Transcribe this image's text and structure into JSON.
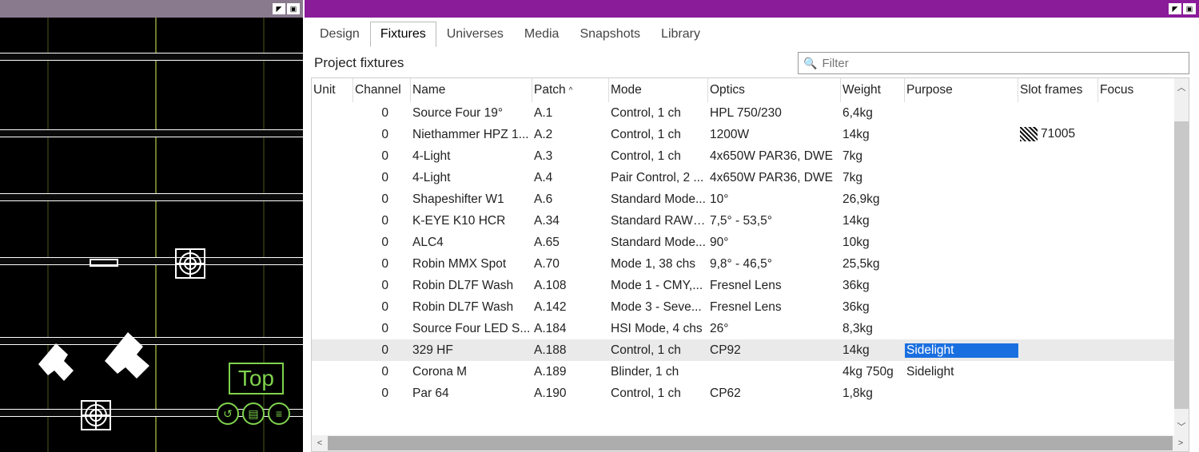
{
  "left": {
    "view_label": "Top"
  },
  "right": {
    "tabs": [
      {
        "label": "Design"
      },
      {
        "label": "Fixtures"
      },
      {
        "label": "Universes"
      },
      {
        "label": "Media"
      },
      {
        "label": "Snapshots"
      },
      {
        "label": "Library"
      }
    ],
    "active_tab": 1,
    "subhead": "Project fixtures",
    "filter_placeholder": "Filter",
    "columns": [
      {
        "label": "Unit"
      },
      {
        "label": "Channel"
      },
      {
        "label": "Name"
      },
      {
        "label": "Patch",
        "sorted": true
      },
      {
        "label": "Mode"
      },
      {
        "label": "Optics"
      },
      {
        "label": "Weight"
      },
      {
        "label": "Purpose"
      },
      {
        "label": "Slot frames"
      },
      {
        "label": "Focus"
      }
    ],
    "rows": [
      {
        "unit": "",
        "channel": "0",
        "name": "Source Four 19°",
        "patch": "A.1",
        "mode": "Control, 1 ch",
        "optics": "HPL 750/230",
        "weight": "6,4kg",
        "purpose": "",
        "slot": "",
        "focus": ""
      },
      {
        "unit": "",
        "channel": "0",
        "name": "Niethammer HPZ 1...",
        "patch": "A.2",
        "mode": "Control, 1 ch",
        "optics": "1200W",
        "weight": "14kg",
        "purpose": "",
        "slot": "71005",
        "slot_icon": true,
        "focus": ""
      },
      {
        "unit": "",
        "channel": "0",
        "name": "4-Light",
        "patch": "A.3",
        "mode": "Control, 1 ch",
        "optics": "4x650W PAR36, DWE",
        "weight": "7kg",
        "purpose": "",
        "slot": "",
        "focus": ""
      },
      {
        "unit": "",
        "channel": "0",
        "name": "4-Light",
        "patch": "A.4",
        "mode": "Pair Control, 2 ...",
        "optics": "4x650W PAR36, DWE",
        "weight": "7kg",
        "purpose": "",
        "slot": "",
        "focus": ""
      },
      {
        "unit": "",
        "channel": "0",
        "name": "Shapeshifter W1",
        "patch": "A.6",
        "mode": "Standard Mode...",
        "optics": "10°",
        "weight": "26,9kg",
        "purpose": "",
        "slot": "",
        "focus": ""
      },
      {
        "unit": "",
        "channel": "0",
        "name": "K-EYE K10 HCR",
        "patch": "A.34",
        "mode": "Standard RAW ...",
        "optics": "7,5° - 53,5°",
        "weight": "14kg",
        "purpose": "",
        "slot": "",
        "focus": ""
      },
      {
        "unit": "",
        "channel": "0",
        "name": "ALC4",
        "patch": "A.65",
        "mode": "Standard Mode...",
        "optics": "90°",
        "weight": "10kg",
        "purpose": "",
        "slot": "",
        "focus": ""
      },
      {
        "unit": "",
        "channel": "0",
        "name": "Robin MMX Spot",
        "patch": "A.70",
        "mode": "Mode 1, 38 chs",
        "optics": "9,8° - 46,5°",
        "weight": "25,5kg",
        "purpose": "",
        "slot": "",
        "focus": ""
      },
      {
        "unit": "",
        "channel": "0",
        "name": "Robin DL7F Wash",
        "patch": "A.108",
        "mode": "Mode 1 - CMY,...",
        "optics": "Fresnel Lens",
        "weight": "36kg",
        "purpose": "",
        "slot": "",
        "focus": ""
      },
      {
        "unit": "",
        "channel": "0",
        "name": "Robin DL7F Wash",
        "patch": "A.142",
        "mode": "Mode 3 - Seve...",
        "optics": "Fresnel Lens",
        "weight": "36kg",
        "purpose": "",
        "slot": "",
        "focus": ""
      },
      {
        "unit": "",
        "channel": "0",
        "name": "Source Four LED S...",
        "patch": "A.184",
        "mode": "HSI Mode, 4 chs",
        "optics": "26°",
        "weight": "8,3kg",
        "purpose": "",
        "slot": "",
        "focus": ""
      },
      {
        "unit": "",
        "channel": "0",
        "name": "329 HF",
        "patch": "A.188",
        "mode": "Control, 1 ch",
        "optics": "CP92",
        "weight": "14kg",
        "purpose": "Sidelight",
        "purpose_sel": true,
        "selected": true,
        "slot": "",
        "focus": ""
      },
      {
        "unit": "",
        "channel": "0",
        "name": "Corona M",
        "patch": "A.189",
        "mode": "Blinder, 1 ch",
        "optics": "",
        "weight": "4kg 750g",
        "purpose": "Sidelight",
        "slot": "",
        "focus": ""
      },
      {
        "unit": "",
        "channel": "0",
        "name": "Par 64",
        "patch": "A.190",
        "mode": "Control, 1 ch",
        "optics": "CP62",
        "weight": "1,8kg",
        "purpose": "",
        "slot": "",
        "focus": ""
      }
    ]
  }
}
